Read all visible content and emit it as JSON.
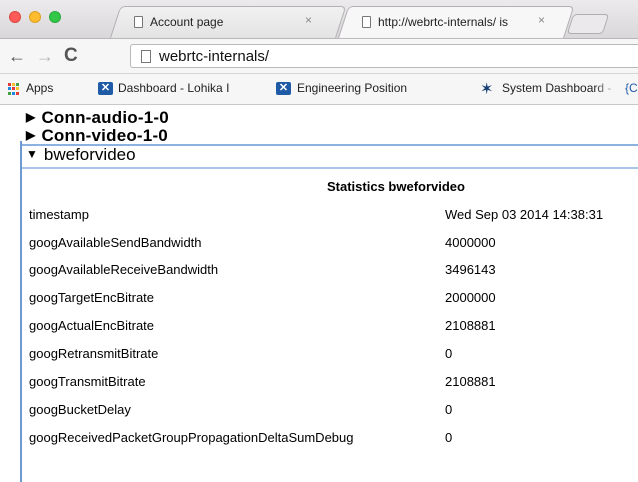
{
  "browser": {
    "tabs": [
      {
        "title": "Account page",
        "close": "×"
      },
      {
        "title": "http://webrtc-internals/ is",
        "close": "×"
      }
    ],
    "toolbar": {
      "back": "←",
      "forward": "→",
      "reload": "C",
      "url": "webrtc-internals/"
    },
    "bookmarks": [
      {
        "label": "Apps"
      },
      {
        "label": "Dashboard - Lohika I"
      },
      {
        "label": "Engineering Position"
      },
      {
        "label": "System Dashboard -"
      },
      {
        "label": "{C"
      }
    ]
  },
  "page": {
    "sections": [
      {
        "label": "Conn-audio-1-0",
        "expanded": false,
        "tri": "▶"
      },
      {
        "label": "Conn-video-1-0",
        "expanded": false,
        "tri": "▶"
      },
      {
        "label": "bweforvideo",
        "expanded": true,
        "tri": "▼"
      }
    ],
    "stats_title": "Statistics bweforvideo",
    "stats": [
      {
        "key": "timestamp",
        "value": "Wed Sep 03 2014 14:38:31"
      },
      {
        "key": "googAvailableSendBandwidth",
        "value": "4000000"
      },
      {
        "key": "googAvailableReceiveBandwidth",
        "value": "3496143"
      },
      {
        "key": "googTargetEncBitrate",
        "value": "2000000"
      },
      {
        "key": "googActualEncBitrate",
        "value": "2108881"
      },
      {
        "key": "googRetransmitBitrate",
        "value": "0"
      },
      {
        "key": "googTransmitBitrate",
        "value": "2108881"
      },
      {
        "key": "googBucketDelay",
        "value": "0"
      },
      {
        "key": "googReceivedPacketGroupPropagationDeltaSumDebug",
        "value": "0"
      }
    ]
  }
}
